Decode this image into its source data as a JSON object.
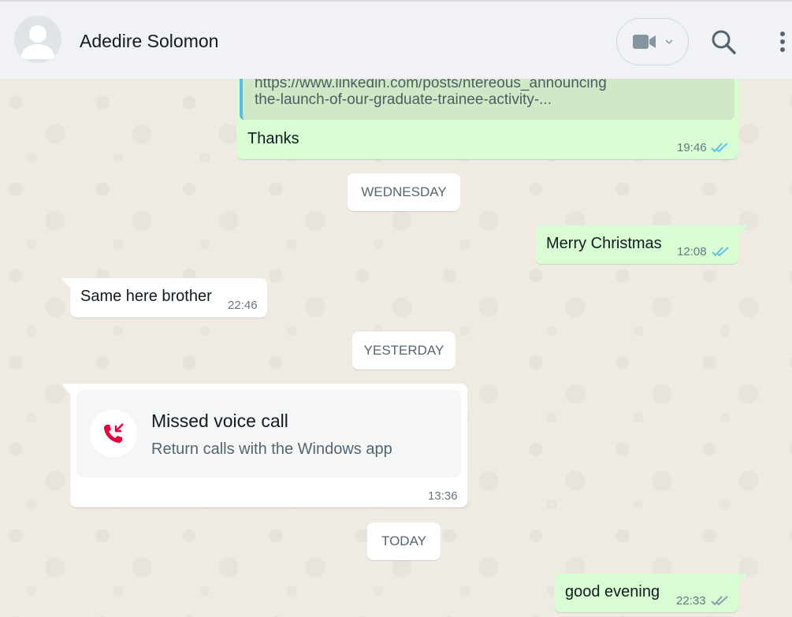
{
  "header": {
    "contact_name": "Adedire Solomon",
    "icons": [
      "default-avatar",
      "video-call-icon",
      "chevron-down-icon",
      "search-icon",
      "kebab-menu-icon"
    ]
  },
  "messages": {
    "link_preview": {
      "line1": "https://www.linkedin.com/posts/ntereous_announcing",
      "line2": "the-launch-of-our-graduate-trainee-activity-..."
    },
    "thanks": {
      "text": "Thanks",
      "time": "19:46"
    },
    "date_wednesday": "WEDNESDAY",
    "merry": {
      "text": "Merry Christmas",
      "time": "12:08"
    },
    "same_here": {
      "text": "Same here brother",
      "time": "22:46"
    },
    "date_yesterday": "YESTERDAY",
    "missed_call": {
      "title": "Missed voice call",
      "subtitle": "Return calls with the Windows app",
      "time": "13:36"
    },
    "date_today": "TODAY",
    "good_evening": {
      "text": "good evening",
      "time": "22:33"
    }
  },
  "colors": {
    "outgoing_bubble": "#d9fdd3",
    "incoming_bubble": "#ffffff",
    "read_ticks": "#53bdeb",
    "delivered_ticks": "#8696a0",
    "missed_call_red": "#ea0038",
    "header_bg": "#f0f2f5",
    "chat_bg": "#efeae2"
  }
}
